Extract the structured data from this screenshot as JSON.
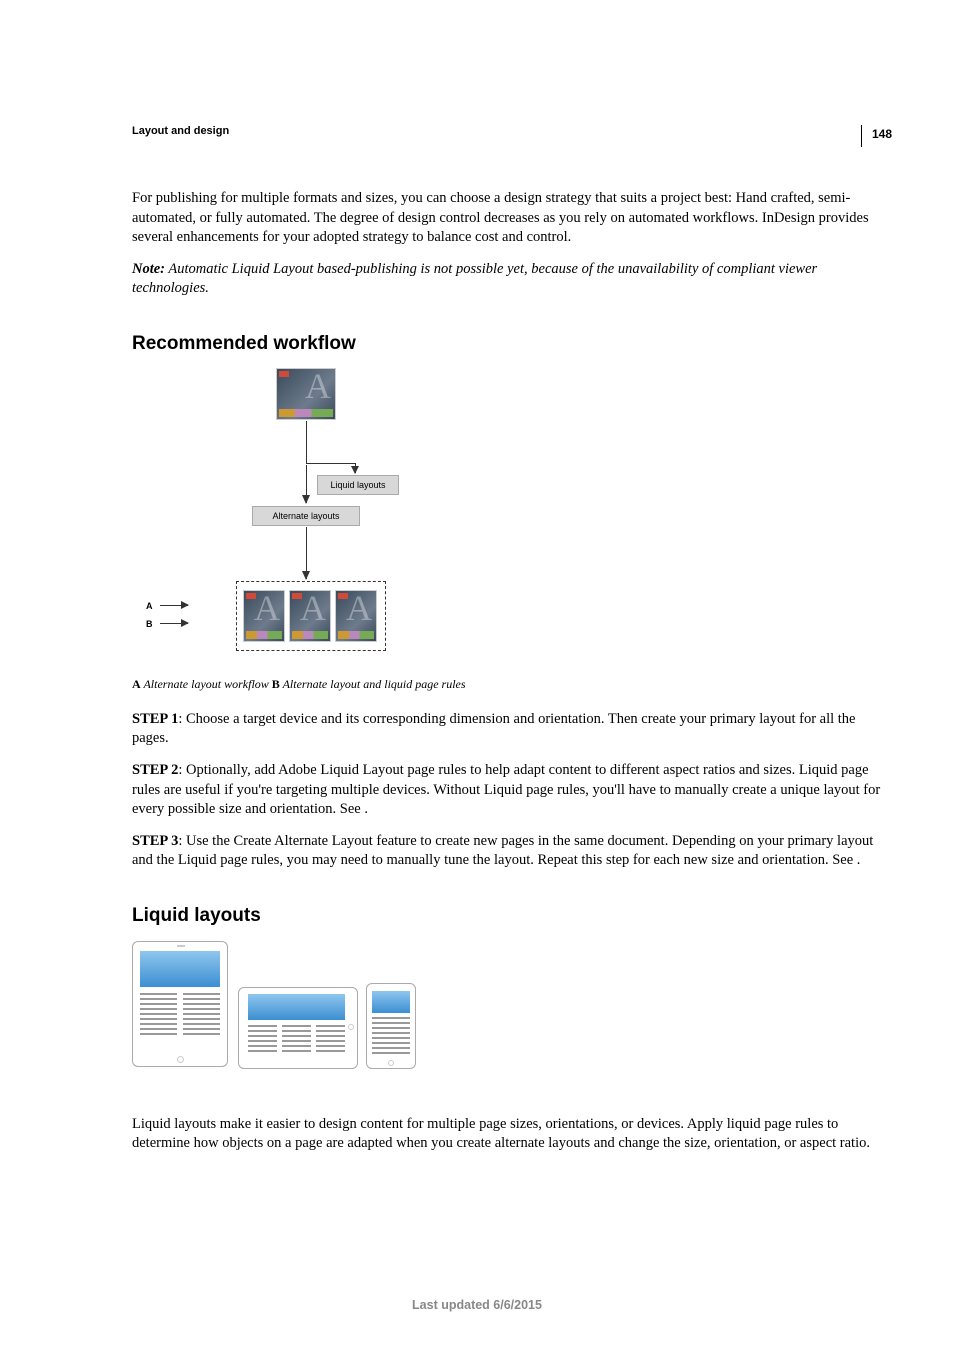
{
  "page_number": "148",
  "section_header": "Layout and design",
  "intro_paragraph": "For publishing for multiple formats and sizes, you can choose a design strategy that suits a project best: Hand crafted, semi-automated, or fully automated. The degree of design control decreases as you rely on automated workflows. InDesign provides several enhancements for your adopted strategy to balance cost and control.",
  "note": {
    "label": "Note:",
    "text": " Automatic Liquid Layout based-publishing is not possible yet, because of the unavailability of compliant viewer technologies."
  },
  "h2_workflow": "Recommended workflow",
  "diagram": {
    "btn_liquid": "Liquid layouts",
    "btn_alternate": "Alternate layouts",
    "side_a": "A",
    "side_b": "B"
  },
  "caption": {
    "key_a": "A",
    "text_a": " Alternate layout workflow  ",
    "key_b": "B",
    "text_b": " Alternate layout and liquid page rules "
  },
  "step1": {
    "label": "STEP 1",
    "text": ": Choose a target device and its corresponding dimension and orientation. Then create your primary layout for all the pages."
  },
  "step2": {
    "label": "STEP 2",
    "text": ": Optionally, add Adobe Liquid Layout page rules to help adapt content to different aspect ratios and sizes. Liquid page rules are useful if you're targeting multiple devices. Without Liquid page rules, you'll have to manually create a unique layout for every possible size and orientation. See ."
  },
  "step3": {
    "label": "STEP 3",
    "text": ": Use the Create Alternate Layout feature to create new pages in the same document. Depending on your primary layout and the Liquid page rules, you may need to manually tune the layout. Repeat this step for each new size and orientation. See ."
  },
  "h2_liquid": "Liquid layouts",
  "liquid_paragraph": "Liquid layouts make it easier to design content for multiple page sizes, orientations, or devices. Apply liquid page rules to determine how objects on a page are adapted when you create alternate layouts and change the size, orientation, or aspect ratio.",
  "footer": "Last updated 6/6/2015"
}
